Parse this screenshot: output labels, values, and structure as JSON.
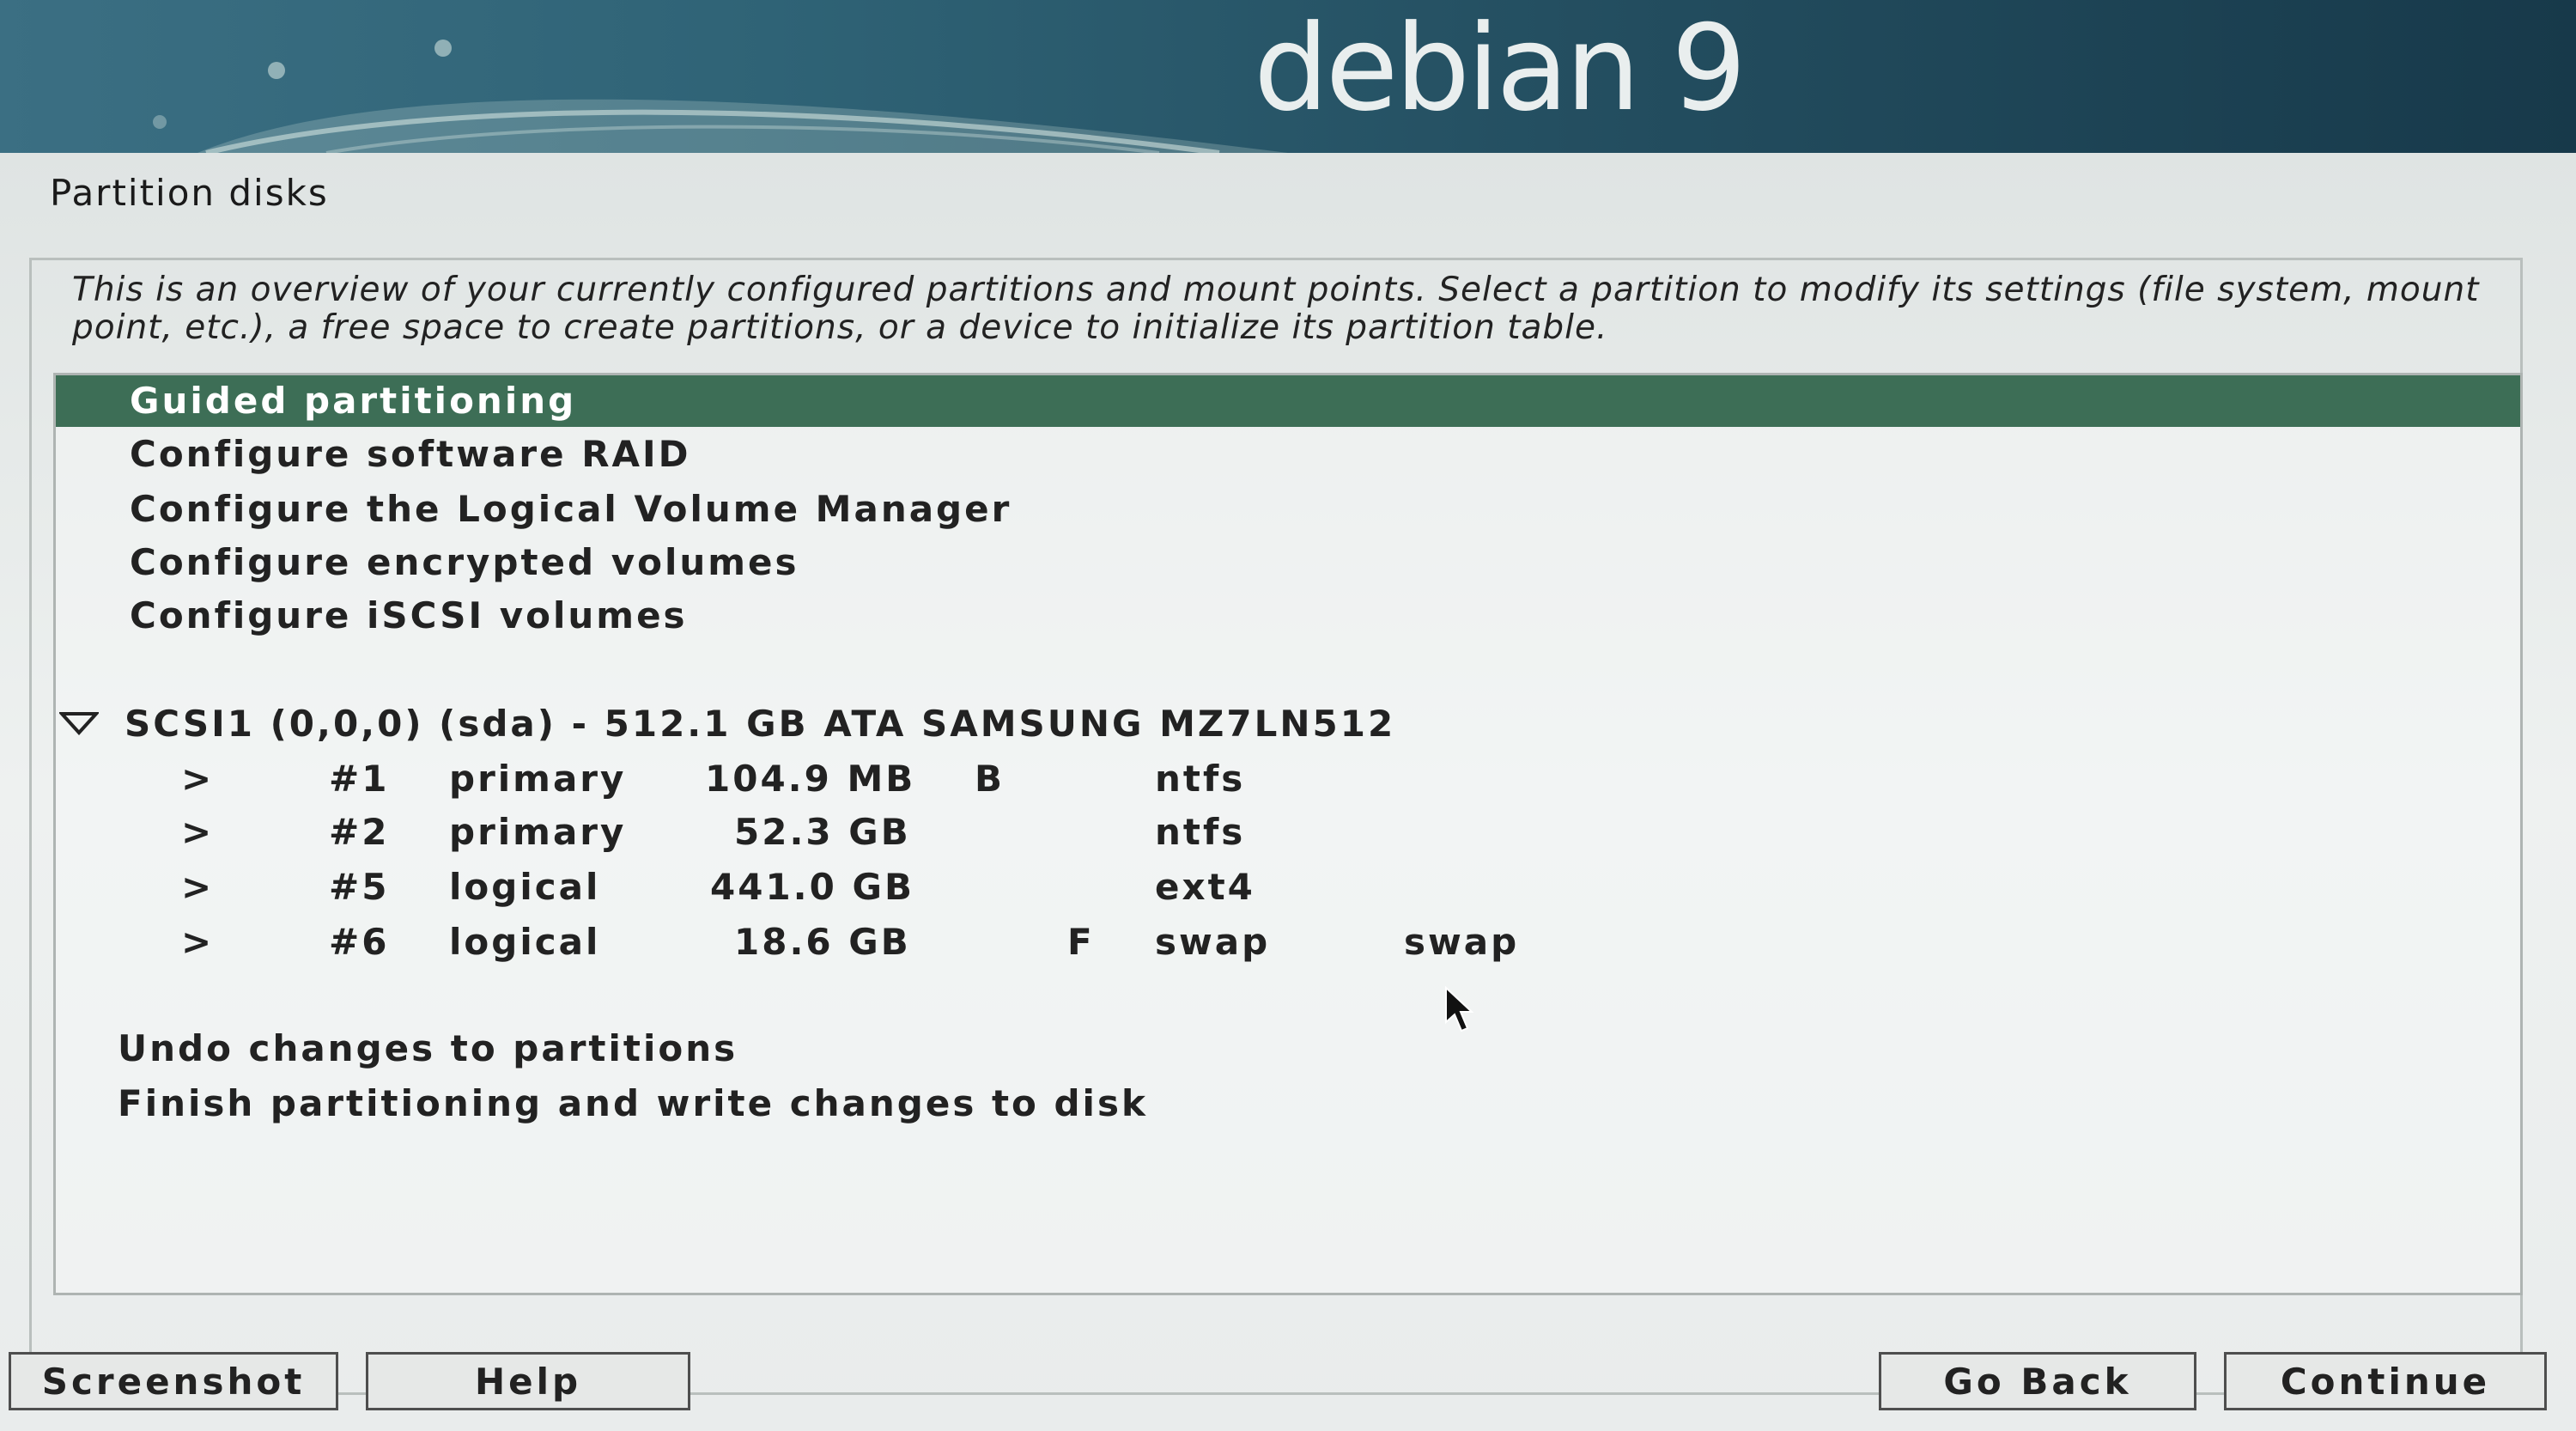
{
  "banner": {
    "title": "debian 9"
  },
  "page": {
    "title": "Partition disks",
    "description": "This is an overview of your currently configured partitions and mount points. Select a partition to modify its settings (file system, mount point, etc.), a free space to create partitions, or a device to initialize its partition table."
  },
  "menu": {
    "items": [
      {
        "label": "Guided partitioning",
        "selected": true
      },
      {
        "label": "Configure software RAID"
      },
      {
        "label": "Configure the Logical Volume Manager"
      },
      {
        "label": "Configure encrypted volumes"
      },
      {
        "label": "Configure iSCSI volumes"
      }
    ]
  },
  "disk": {
    "expand_icon": "triangle-down-icon",
    "label": "SCSI1 (0,0,0) (sda) - 512.1 GB ATA SAMSUNG MZ7LN512",
    "partitions": [
      {
        "arrow": ">",
        "number": "#1",
        "type": "primary",
        "size": "104.9 MB",
        "flag": "B",
        "format": "",
        "fs": "ntfs",
        "mount": ""
      },
      {
        "arrow": ">",
        "number": "#2",
        "type": "primary",
        "size": "52.3 GB",
        "flag": "",
        "format": "",
        "fs": "ntfs",
        "mount": ""
      },
      {
        "arrow": ">",
        "number": "#5",
        "type": "logical",
        "size": "441.0 GB",
        "flag": "",
        "format": "",
        "fs": "ext4",
        "mount": ""
      },
      {
        "arrow": ">",
        "number": "#6",
        "type": "logical",
        "size": "18.6 GB",
        "flag": "",
        "format": "F",
        "fs": "swap",
        "mount": "swap"
      }
    ]
  },
  "actions": {
    "undo": "Undo changes to partitions",
    "finish": "Finish partitioning and write changes to disk"
  },
  "buttons": {
    "screenshot": "Screenshot",
    "help": "Help",
    "go_back": "Go Back",
    "continue": "Continue"
  },
  "colors": {
    "selection": "#3d6e56",
    "banner": "#2f6376"
  }
}
